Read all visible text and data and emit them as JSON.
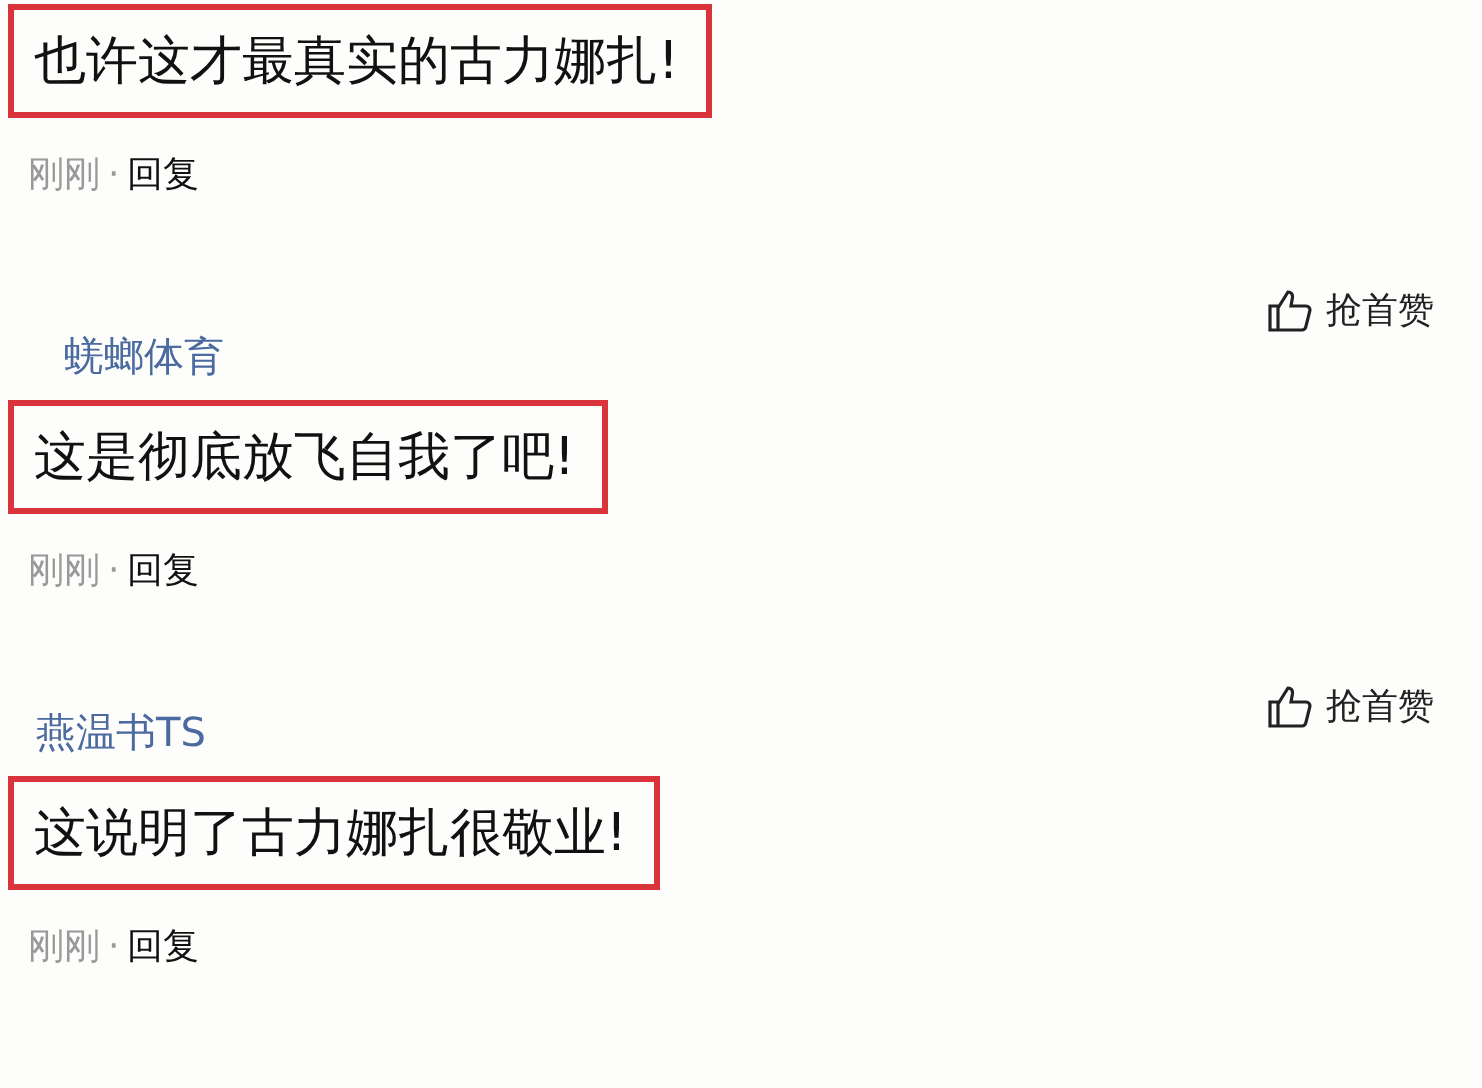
{
  "comments": [
    {
      "text": "也许这才最真实的古力娜扎!",
      "highlighted": true,
      "time": "刚刚",
      "separator": "·",
      "reply": "回复"
    },
    {
      "like": "抢首赞",
      "user": "蜣螂体育",
      "text": "这是彻底放飞自我了吧!",
      "highlighted": true,
      "time": "刚刚",
      "separator": "·",
      "reply": "回复"
    },
    {
      "like": "抢首赞",
      "user": "燕温书TS",
      "text": "这说明了古力娜扎很敬业!",
      "highlighted": true,
      "time": "刚刚",
      "separator": "·",
      "reply": "回复"
    }
  ]
}
